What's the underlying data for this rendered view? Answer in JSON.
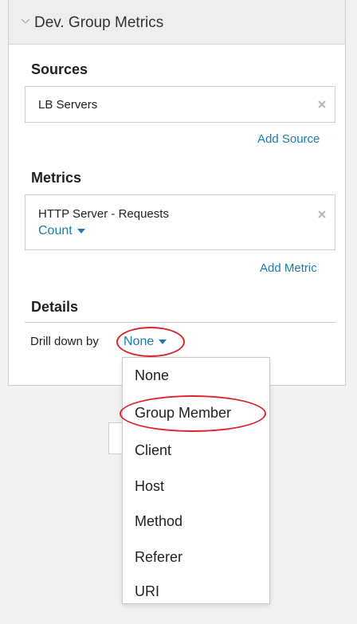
{
  "panel": {
    "title": "Dev. Group Metrics"
  },
  "sources": {
    "heading": "Sources",
    "items": [
      {
        "label": "LB Servers"
      }
    ],
    "add_link": "Add Source"
  },
  "metrics": {
    "heading": "Metrics",
    "items": [
      {
        "label": "HTTP Server - Requests",
        "type": "Count"
      }
    ],
    "add_link": "Add Metric"
  },
  "details": {
    "heading": "Details",
    "drill_label": "Drill down by",
    "drill_value": "None"
  },
  "dropdown": {
    "options": [
      "None",
      "Group Member",
      "Client",
      "Host",
      "Method",
      "Referer",
      "URI"
    ],
    "highlighted": "Group Member"
  },
  "colors": {
    "link": "#1a7dad",
    "annotation": "#d9262b"
  }
}
